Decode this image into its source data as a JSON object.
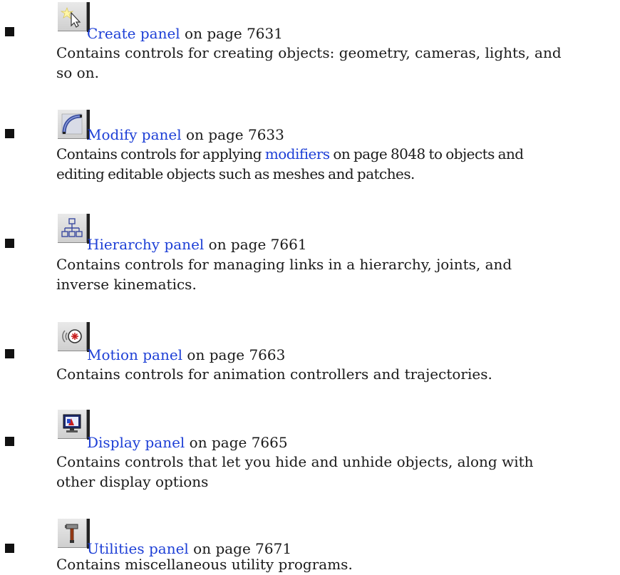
{
  "entries": [
    {
      "icon": "create-sparkle-cursor-icon",
      "link": "Create panel",
      "page_ref": " on page 7631",
      "desc": "Contains controls for creating objects: geometry, cameras, lights, and so on."
    },
    {
      "icon": "modify-arc-icon",
      "link": "Modify panel",
      "page_ref": " on page 7633",
      "desc_before": "Contains controls for applying ",
      "desc_link": "modifiers",
      "desc_after": " on page 8048 to objects and editing editable objects such as meshes and patches."
    },
    {
      "icon": "hierarchy-tree-icon",
      "link": "Hierarchy panel",
      "page_ref": " on page 7661",
      "desc": "Contains controls for managing links in a hierarchy, joints, and inverse kinematics."
    },
    {
      "icon": "motion-wheel-icon",
      "link": "Motion panel",
      "page_ref": " on page 7663",
      "desc": "Contains controls for animation controllers and trajectories."
    },
    {
      "icon": "display-monitor-icon",
      "link": "Display panel",
      "page_ref": " on page 7665",
      "desc": "Contains controls that let you hide and unhide objects, along with other display options"
    },
    {
      "icon": "utilities-hammer-icon",
      "link": "Utilities panel",
      "page_ref": " on page 7671",
      "desc": "Contains miscellaneous utility programs."
    }
  ]
}
